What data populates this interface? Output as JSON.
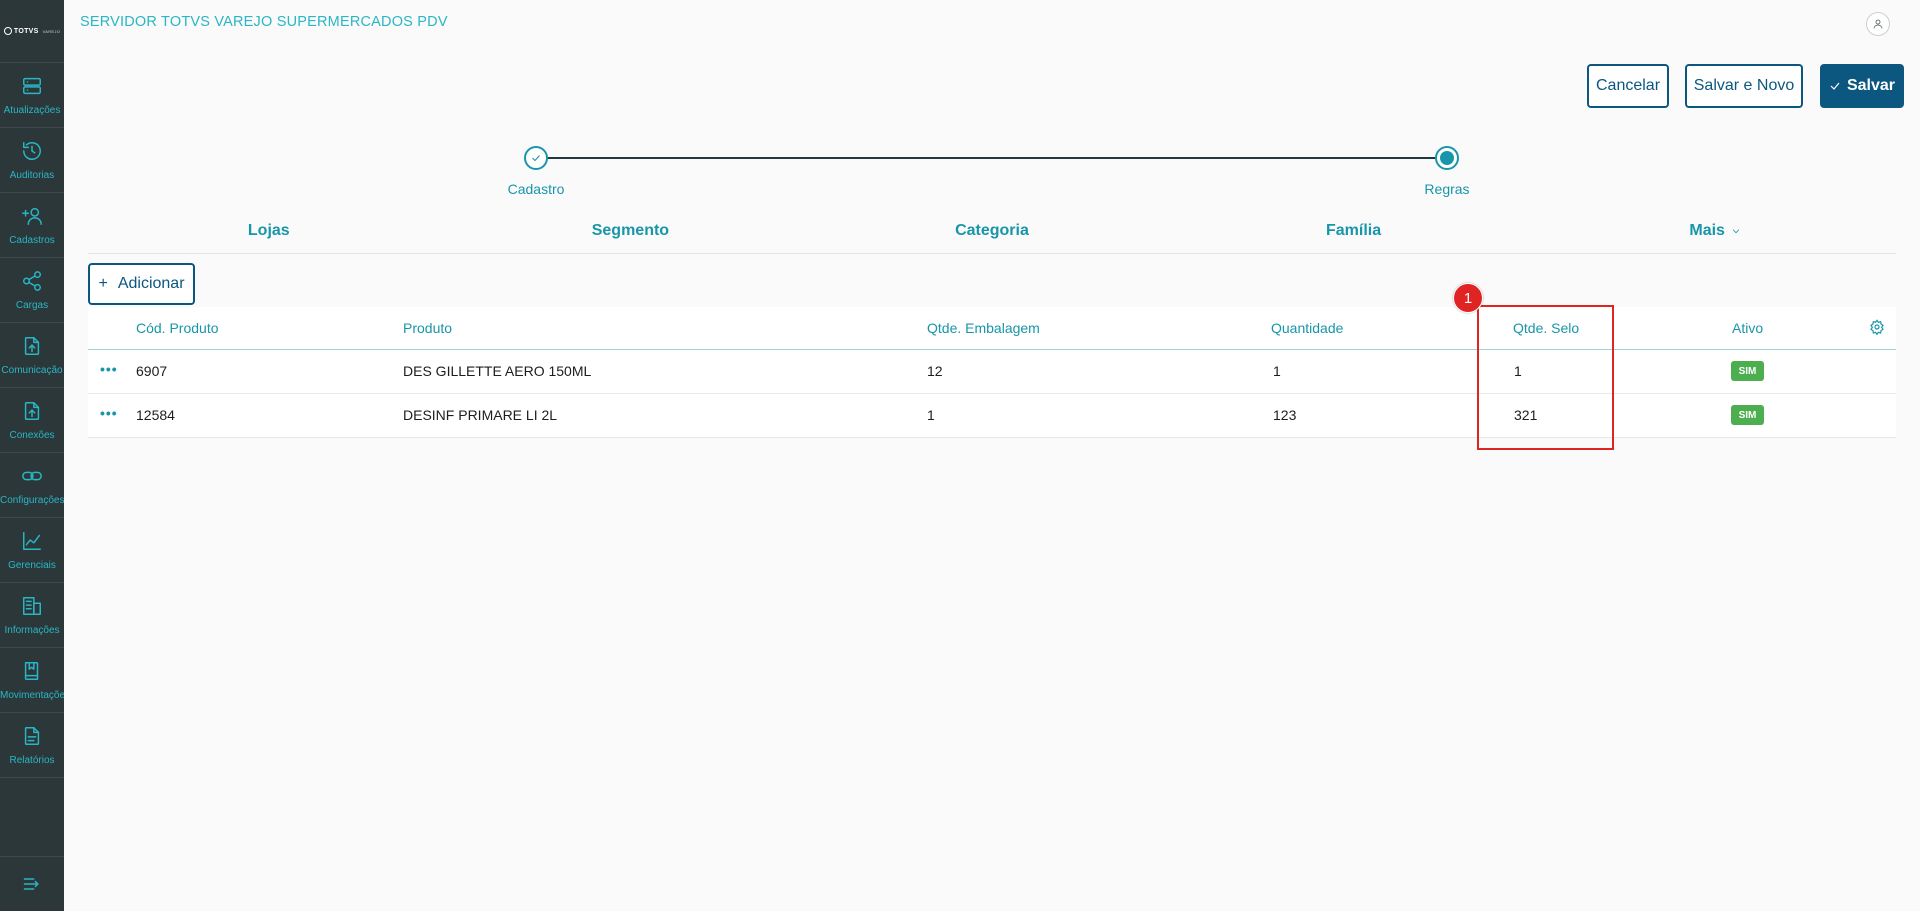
{
  "header": {
    "app_title": "SERVIDOR TOTVS VAREJO SUPERMERCADOS PDV",
    "logo_text": "TOTVS",
    "logo_sub": "VAREJO"
  },
  "sidebar": {
    "items": [
      {
        "label": "Atualizações",
        "icon": "server-icon"
      },
      {
        "label": "Auditorias",
        "icon": "history-icon"
      },
      {
        "label": "Cadastros",
        "icon": "add-user-icon"
      },
      {
        "label": "Cargas",
        "icon": "share-icon"
      },
      {
        "label": "Comunicação",
        "icon": "file-upload-icon"
      },
      {
        "label": "Conexões",
        "icon": "file-upload-icon"
      },
      {
        "label": "Configurações",
        "icon": "link-icon"
      },
      {
        "label": "Gerenciais",
        "icon": "chart-icon"
      },
      {
        "label": "Informações",
        "icon": "building-icon"
      },
      {
        "label": "Movimentações",
        "icon": "book-icon"
      },
      {
        "label": "Relatórios",
        "icon": "document-icon"
      }
    ]
  },
  "actions": {
    "cancel": "Cancelar",
    "save_new": "Salvar e Novo",
    "save": "Salvar"
  },
  "stepper": {
    "steps": [
      {
        "label": "Cadastro",
        "state": "done"
      },
      {
        "label": "Regras",
        "state": "active"
      }
    ]
  },
  "tabs": [
    {
      "label": "Lojas"
    },
    {
      "label": "Segmento"
    },
    {
      "label": "Categoria"
    },
    {
      "label": "Família"
    },
    {
      "label": "Mais"
    }
  ],
  "add_button": "Adicionar",
  "table": {
    "columns": [
      "Cód. Produto",
      "Produto",
      "Qtde. Embalagem",
      "Quantidade",
      "Qtde. Selo",
      "Ativo"
    ],
    "rows": [
      {
        "codigo": "6907",
        "produto": "DES GILLETTE AERO 150ML",
        "embalagem": "12",
        "quantidade": "1",
        "selo": "1",
        "ativo": "SIM"
      },
      {
        "codigo": "12584",
        "produto": "DESINF PRIMARE LI 2L",
        "embalagem": "1",
        "quantidade": "123",
        "selo": "321",
        "ativo": "SIM"
      }
    ]
  },
  "annotation": {
    "marker": "1"
  },
  "colors": {
    "sidebar_bg": "#2c3739",
    "accent": "#1896a9",
    "primary": "#0c5780",
    "success": "#4cae4e",
    "annotation": "#e02424"
  }
}
